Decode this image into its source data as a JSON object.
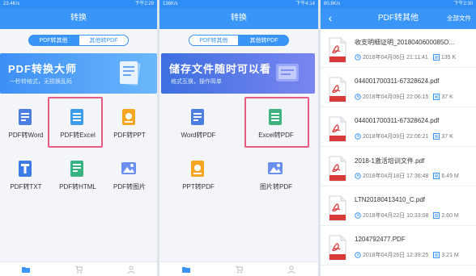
{
  "colors": {
    "accent": "#3a95f8",
    "highlight": "#e85b80",
    "pdf_red": "#d83a3a"
  },
  "panel1": {
    "status_left": "23.4K/s",
    "status_right": "下午2:29",
    "title": "转换",
    "tabs": [
      {
        "label": "PDF转其他",
        "active": true
      },
      {
        "label": "其他转PDF",
        "active": false
      }
    ],
    "banner_title": "PDF转换大师",
    "banner_sub": "一秒转格式，无损换乱码",
    "items": [
      {
        "label": "PDF转Word",
        "icon": "word-icon"
      },
      {
        "label": "PDF转Excel",
        "icon": "excel-icon"
      },
      {
        "label": "PDF转PPT",
        "icon": "ppt-icon"
      },
      {
        "label": "PDF转TXT",
        "icon": "txt-icon"
      },
      {
        "label": "PDF转HTML",
        "icon": "html-icon"
      },
      {
        "label": "PDF转图片",
        "icon": "image-icon"
      }
    ]
  },
  "panel2": {
    "status_left": "136K/s",
    "status_right": "下午4:14",
    "title": "转换",
    "tabs": [
      {
        "label": "PDF转其他",
        "active": false
      },
      {
        "label": "其他转PDF",
        "active": true
      }
    ],
    "banner_title": "储存文件随时可以看",
    "banner_sub": "格式互换，操作简单",
    "items": [
      {
        "label": "Word转PDF",
        "icon": "word-icon"
      },
      {
        "label": "Excel转PDF",
        "icon": "excel-icon"
      },
      {
        "label": "PPT转PDF",
        "icon": "ppt-icon"
      },
      {
        "label": "图片转PDF",
        "icon": "image-icon"
      }
    ]
  },
  "panel3": {
    "status_left": "80.8K/s",
    "status_right": "下午2:30",
    "title": "PDF转其他",
    "right_link": "全部文件",
    "files": [
      {
        "name": "收支明细证明_2018040600085O...",
        "date": "2018年04月06日 21:11:41",
        "size": "135 K"
      },
      {
        "name": "044001700311-67328624.pdf",
        "date": "2018年04月09日 22:06:15",
        "size": "37 K"
      },
      {
        "name": "044001700311-67328624.pdf",
        "date": "2018年04月09日 22:06:21",
        "size": "37 K"
      },
      {
        "name": "2018-1激活培训文件.pdf",
        "date": "2018年04月18日 17:36:48",
        "size": "6.49 M"
      },
      {
        "name": "LTN20180413410_C.pdf",
        "date": "2018年04月22日 10:33:08",
        "size": "2.60 M"
      },
      {
        "name": "1204792477.PDF",
        "date": "2018年04月26日 12:39:25",
        "size": "3.21 M"
      }
    ]
  }
}
